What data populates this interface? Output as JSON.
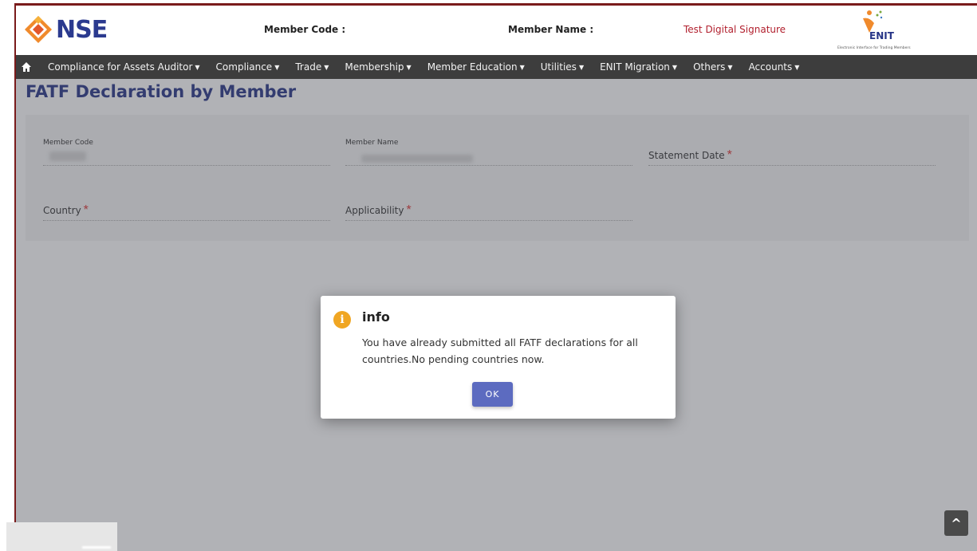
{
  "header": {
    "logo_text": "NSE",
    "member_code_label": "Member Code :",
    "member_name_label": "Member Name :",
    "member_name_value": "Test Digital Signature",
    "enit_logo_text": "ENIT",
    "enit_tagline": "Electronic Interface for Trading Members"
  },
  "nav": {
    "items": [
      {
        "label": "Compliance for Assets Auditor"
      },
      {
        "label": "Compliance"
      },
      {
        "label": "Trade"
      },
      {
        "label": "Membership"
      },
      {
        "label": "Member Education"
      },
      {
        "label": "Utilities"
      },
      {
        "label": "ENIT Migration"
      },
      {
        "label": "Others"
      },
      {
        "label": "Accounts"
      }
    ]
  },
  "page": {
    "title": "FATF Declaration by Member"
  },
  "form": {
    "member_code_label": "Member Code",
    "member_name_label": "Member Name",
    "statement_date_label": "Statement Date",
    "country_label": "Country",
    "applicability_label": "Applicability",
    "required_mark": "*"
  },
  "dialog": {
    "title": "info",
    "message": "You have already submitted all FATF declarations for all countries.No pending countries now.",
    "ok_label": "OK"
  },
  "scroll_top": {
    "label": "^"
  },
  "colors": {
    "brand_blue": "#273587",
    "nav_bg": "#3d3d3d",
    "accent_red": "#b11f2d",
    "button": "#5c6bc0",
    "info_icon": "#f0a623"
  }
}
